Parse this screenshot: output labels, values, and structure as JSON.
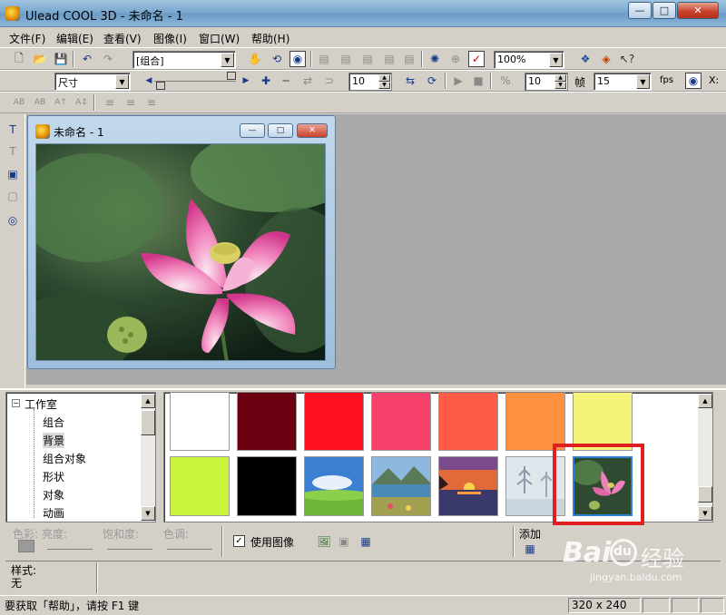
{
  "app": {
    "title": "Ulead COOL 3D - 未命名 - 1",
    "buttons": {
      "minimize": "—",
      "maximize": "□",
      "close": "✕"
    }
  },
  "menu": [
    "文件(F)",
    "编辑(E)",
    "查看(V)",
    "图像(I)",
    "窗口(W)",
    "帮助(H)"
  ],
  "toolbar1": {
    "object_combo": "[组合]",
    "zoom_combo": "100%"
  },
  "toolbar2": {
    "mode_combo": "尺寸",
    "frame_value": "10",
    "frame2_value": "10",
    "frame_label": "帧",
    "fps_value": "15",
    "fps_label": "fps",
    "x_label": "X:"
  },
  "child_window": {
    "title": "未命名 - 1"
  },
  "tree": {
    "root": "工作室",
    "items": [
      "组合",
      "背景",
      "组合对象",
      "形状",
      "对象",
      "动画"
    ],
    "selected": "背景"
  },
  "gallery": {
    "row1": [
      "#ffffff",
      "#6b0010",
      "#ff1020",
      "#f5416a",
      "#ff5a45",
      "#ff9040",
      "#f4f47a"
    ],
    "row2": [
      "#c9f53d",
      "#000000",
      "sky-field",
      "lake-mountain",
      "sunset-lake",
      "winter-trees",
      "lotus-photo"
    ]
  },
  "color_panel": {
    "color_label": "色彩:",
    "brightness_label": "亮度:",
    "saturation_label": "饱和度:",
    "hue_label": "色调:",
    "use_image_label": "使用图像",
    "use_image_checked": "✓",
    "add_label": "添加",
    "style_label": "样式:",
    "style_value": "无"
  },
  "status": {
    "hint": "要获取「帮助」，请按 F1 键",
    "size": "320 x 240"
  },
  "watermark": {
    "brand": "Bai",
    "brand2": "du",
    "suffix": "经验",
    "url": "jingyan.baidu.com"
  },
  "colors": {
    "workspace": "#a9a9a9",
    "highlight": "#e02020",
    "selection": "#2d7fd2"
  }
}
